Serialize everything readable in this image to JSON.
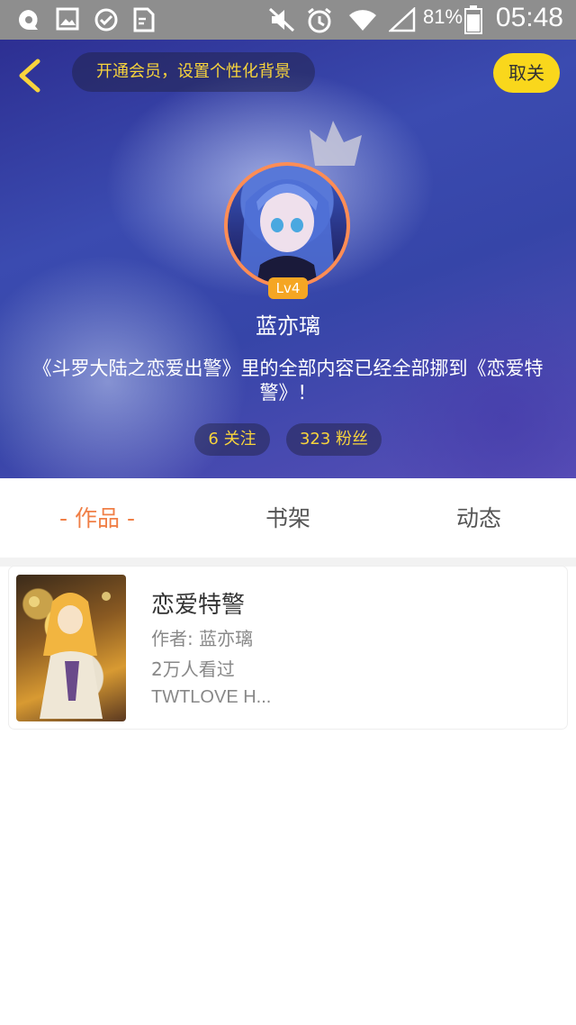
{
  "status_bar": {
    "battery": "81%",
    "time": "05:48"
  },
  "header": {
    "vip_prompt": "开通会员，设置个性化背景",
    "unfollow_label": "取关"
  },
  "profile": {
    "level": "Lv4",
    "name": "蓝亦璃",
    "signature": "《斗罗大陆之恋爱出警》里的全部内容已经全部挪到《恋爱特警》！",
    "follows": "6 关注",
    "fans": "323 粉丝"
  },
  "tabs": [
    {
      "label": "- 作品 -",
      "active": true
    },
    {
      "label": "书架",
      "active": false
    },
    {
      "label": "动态",
      "active": false
    }
  ],
  "books": [
    {
      "title": "恋爱特警",
      "author": "作者: 蓝亦璃",
      "views": "2万人看过",
      "tags": "TWTLOVE  H..."
    }
  ],
  "colors": {
    "accent": "#f07f46",
    "gold": "#f8d43c",
    "follow_button": "#f9d71c",
    "level_badge": "#f5a623"
  }
}
